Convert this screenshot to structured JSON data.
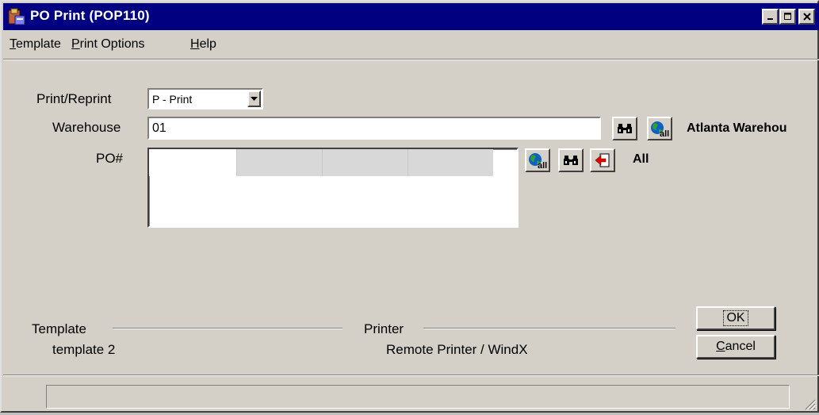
{
  "window": {
    "title": "PO Print (POP110)"
  },
  "menu": {
    "items": [
      {
        "accel": "T",
        "rest": "emplate"
      },
      {
        "accel": "P",
        "rest": "rint Options"
      },
      {
        "accel": "H",
        "rest": "elp"
      }
    ]
  },
  "form": {
    "print_reprint_label": "Print/Reprint",
    "print_reprint_value": "P - Print",
    "warehouse_label": "Warehouse",
    "warehouse_value": "01",
    "warehouse_name": "Atlanta Warehou",
    "po_label": "PO#",
    "po_all_text": "All"
  },
  "template": {
    "title": "Template",
    "value": "template 2"
  },
  "printer": {
    "title": "Printer",
    "value": "Remote Printer / WindX"
  },
  "buttons": {
    "ok_label": "OK",
    "cancel_accel": "C",
    "cancel_rest": "ancel"
  },
  "status": {
    "text": ""
  },
  "icons": {
    "app": "app-icon",
    "find": "binoculars-icon",
    "lookup": "globe-lookup-icon",
    "all": "all-select-icon",
    "dropdown": "dropdown-arrow-icon",
    "grip": "size-grip-icon"
  },
  "colors": {
    "titlebar": "#000080",
    "face": "#d4d0c8",
    "grid_header": "#d8d8d8"
  }
}
